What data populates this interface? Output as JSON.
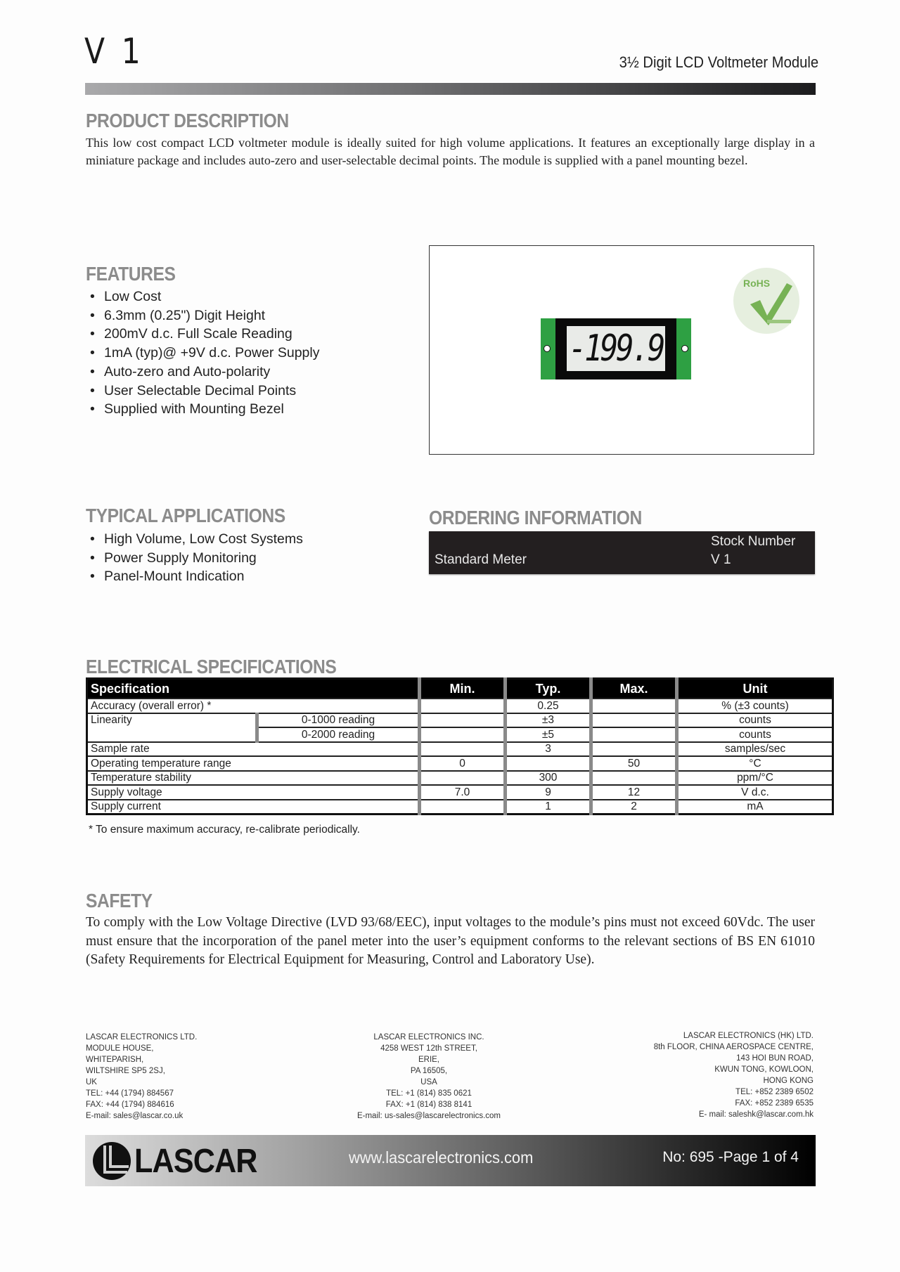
{
  "header": {
    "title": "V 1",
    "subtitle": "3½ Digit LCD Voltmeter Module"
  },
  "product_description": {
    "heading": "PRODUCT DESCRIPTION",
    "text": "This low cost compact LCD voltmeter module is ideally suited for high volume applications. It features  an exceptionally large display in a miniature package and includes auto-zero and user-selectable decimal points. The module is supplied with a panel mounting bezel."
  },
  "features": {
    "heading": "FEATURES",
    "items": [
      "Low Cost",
      "6.3mm (0.25\") Digit Height",
      "200mV d.c. Full Scale Reading",
      "1mA (typ)@ +9V d.c. Power Supply",
      "Auto-zero and Auto-polarity",
      "User Selectable Decimal Points",
      "Supplied with Mounting Bezel"
    ]
  },
  "product_image": {
    "display_reading": "-199.9",
    "badge_text": "RoHS",
    "colors": {
      "tab": "#2ea043",
      "badge_check": "#77b255"
    }
  },
  "typical_applications": {
    "heading": "TYPICAL APPLICATIONS",
    "items": [
      "High Volume, Low Cost Systems",
      "Power Supply Monitoring",
      "Panel-Mount Indication"
    ]
  },
  "ordering_information": {
    "heading": "ORDERING INFORMATION",
    "column_header": "Stock Number",
    "rows": [
      {
        "label": "Standard Meter",
        "stock_number": "V 1"
      }
    ]
  },
  "electrical_specifications": {
    "heading": "ELECTRICAL SPECIFICATIONS",
    "columns": [
      "Specification",
      "Min.",
      "Typ.",
      "Max.",
      "Unit"
    ],
    "rows": [
      {
        "spec": "Accuracy (overall error)  *",
        "sub": "",
        "min": "",
        "typ": "0.25",
        "max": "",
        "unit": "% (±3 counts)"
      },
      {
        "spec": "Linearity",
        "sub": "0-1000 reading",
        "min": "",
        "typ": "±3",
        "max": "",
        "unit": "counts"
      },
      {
        "spec": "",
        "sub": "0-2000 reading",
        "min": "",
        "typ": "±5",
        "max": "",
        "unit": "counts"
      },
      {
        "spec": "Sample rate",
        "sub": "",
        "min": "",
        "typ": "3",
        "max": "",
        "unit": "samples/sec"
      },
      {
        "spec": "Operating temperature range",
        "sub": "",
        "min": "0",
        "typ": "",
        "max": "50",
        "unit": "°C"
      },
      {
        "spec": "Temperature stability",
        "sub": "",
        "min": "",
        "typ": "300",
        "max": "",
        "unit": "ppm/°C"
      },
      {
        "spec": "Supply voltage",
        "sub": "",
        "min": "7.0",
        "typ": "9",
        "max": "12",
        "unit": "V d.c."
      },
      {
        "spec": "Supply current",
        "sub": "",
        "min": "",
        "typ": "1",
        "max": "2",
        "unit": "mA"
      }
    ],
    "footnote": "* To ensure maximum accuracy, re-calibrate periodically."
  },
  "safety": {
    "heading": "SAFETY",
    "text": "To comply with the Low Voltage Directive (LVD 93/68/EEC), input voltages to the module’s pins must not exceed 60Vdc. The user must ensure that the incorporation of the panel meter into the user’s equipment conforms to the relevant sections of BS EN 61010 (Safety Requirements for Electrical Equipment for Measuring, Control and Laboratory Use)."
  },
  "addresses": {
    "uk": "LASCAR ELECTRONICS LTD.\nMODULE HOUSE,\nWHITEPARISH,\nWILTSHIRE  SP5 2SJ,\nUK\nTEL: +44 (1794) 884567\nFAX: +44 (1794) 884616\nE-mail: sales@lascar.co.uk",
    "us": "LASCAR ELECTRONICS INC.\n4258  WEST 12th STREET,\nERIE,\nPA 16505,\nUSA\nTEL: +1 (814) 835 0621\nFAX: +1 (814) 838 8141\nE-mail: us-sales@lascarelectronics.com",
    "hk": "LASCAR ELECTRONICS (HK) LTD.\n8th FLOOR,  CHINA AEROSPACE CENTRE,\n143 HOI BUN ROAD,\nKWUN TONG,  KOWLOON,\nHONG KONG\nTEL: +852 2389 6502\nFAX: +852 2389 6535\nE- mail: saleshk@lascar.com.hk"
  },
  "footer": {
    "logo_text": "LASCAR",
    "url": "www.lascarelectronics.com",
    "page_info": "No: 695 -Page 1 of 4"
  }
}
